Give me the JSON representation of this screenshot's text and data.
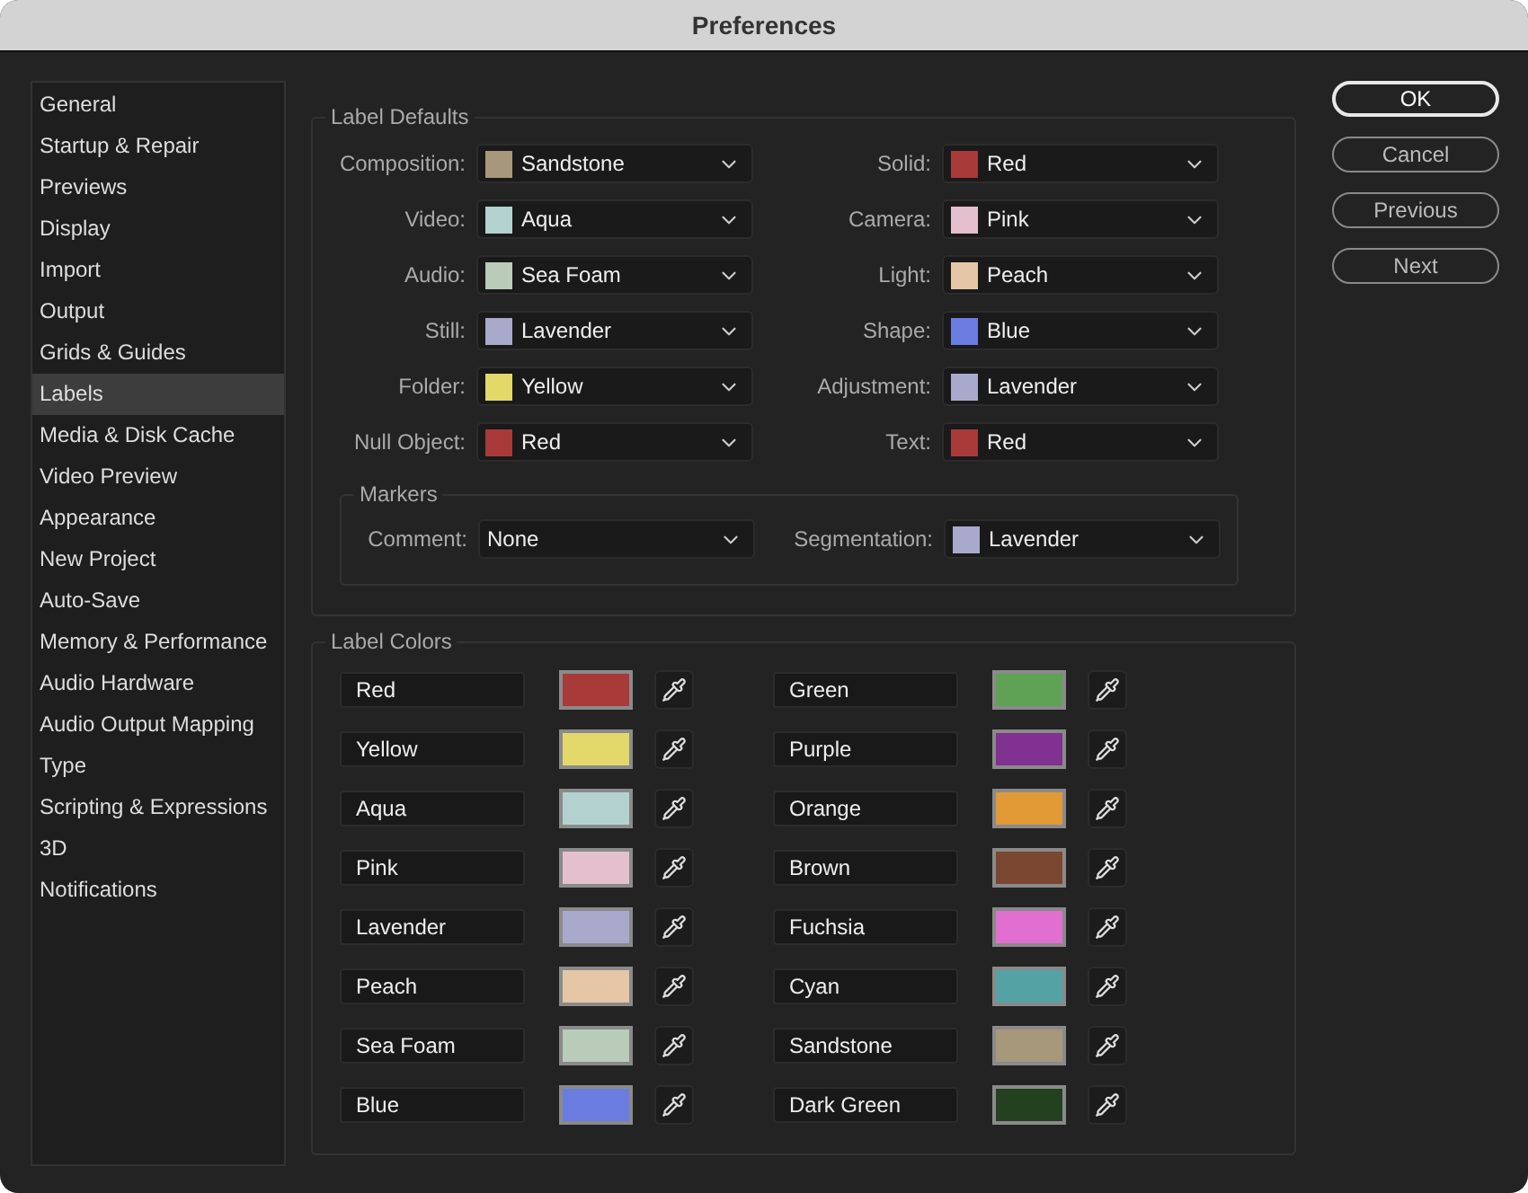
{
  "window": {
    "title": "Preferences"
  },
  "sidebar": {
    "items": [
      {
        "label": "General",
        "selected": false
      },
      {
        "label": "Startup & Repair",
        "selected": false
      },
      {
        "label": "Previews",
        "selected": false
      },
      {
        "label": "Display",
        "selected": false
      },
      {
        "label": "Import",
        "selected": false
      },
      {
        "label": "Output",
        "selected": false
      },
      {
        "label": "Grids & Guides",
        "selected": false
      },
      {
        "label": "Labels",
        "selected": true
      },
      {
        "label": "Media & Disk Cache",
        "selected": false
      },
      {
        "label": "Video Preview",
        "selected": false
      },
      {
        "label": "Appearance",
        "selected": false
      },
      {
        "label": "New Project",
        "selected": false
      },
      {
        "label": "Auto-Save",
        "selected": false
      },
      {
        "label": "Memory & Performance",
        "selected": false
      },
      {
        "label": "Audio Hardware",
        "selected": false
      },
      {
        "label": "Audio Output Mapping",
        "selected": false
      },
      {
        "label": "Type",
        "selected": false
      },
      {
        "label": "Scripting & Expressions",
        "selected": false
      },
      {
        "label": "3D",
        "selected": false
      },
      {
        "label": "Notifications",
        "selected": false
      }
    ]
  },
  "label_defaults": {
    "title": "Label Defaults",
    "fields": [
      {
        "label": "Composition:",
        "value": "Sandstone",
        "color": "#a7987c"
      },
      {
        "label": "Solid:",
        "value": "Red",
        "color": "#a83a3a"
      },
      {
        "label": "Video:",
        "value": "Aqua",
        "color": "#b3d1cf"
      },
      {
        "label": "Camera:",
        "value": "Pink",
        "color": "#e4bfcd"
      },
      {
        "label": "Audio:",
        "value": "Sea Foam",
        "color": "#b8ccb9"
      },
      {
        "label": "Light:",
        "value": "Peach",
        "color": "#e5c6a6"
      },
      {
        "label": "Still:",
        "value": "Lavender",
        "color": "#a9a9cb"
      },
      {
        "label": "Shape:",
        "value": "Blue",
        "color": "#6b7ce0"
      },
      {
        "label": "Folder:",
        "value": "Yellow",
        "color": "#e3d96a"
      },
      {
        "label": "Adjustment:",
        "value": "Lavender",
        "color": "#a9a9cb"
      },
      {
        "label": "Null Object:",
        "value": "Red",
        "color": "#a83a3a"
      },
      {
        "label": "Text:",
        "value": "Red",
        "color": "#a83a3a"
      }
    ],
    "markers": {
      "title": "Markers",
      "fields": [
        {
          "label": "Comment:",
          "value": "None"
        },
        {
          "label": "Segmentation:",
          "value": "Lavender",
          "color": "#a9a9cb"
        }
      ]
    }
  },
  "label_colors": {
    "title": "Label Colors",
    "items": [
      {
        "name": "Red",
        "color": "#a83a3a"
      },
      {
        "name": "Green",
        "color": "#5fa256"
      },
      {
        "name": "Yellow",
        "color": "#e3d96a"
      },
      {
        "name": "Purple",
        "color": "#81318f"
      },
      {
        "name": "Aqua",
        "color": "#b3d1cf"
      },
      {
        "name": "Orange",
        "color": "#e19a35"
      },
      {
        "name": "Pink",
        "color": "#e4bfcd"
      },
      {
        "name": "Brown",
        "color": "#7a4730"
      },
      {
        "name": "Lavender",
        "color": "#a9a9cb"
      },
      {
        "name": "Fuchsia",
        "color": "#e06fd0"
      },
      {
        "name": "Peach",
        "color": "#e5c6a6"
      },
      {
        "name": "Cyan",
        "color": "#55a2a5"
      },
      {
        "name": "Sea Foam",
        "color": "#b8ccb9"
      },
      {
        "name": "Sandstone",
        "color": "#a7987c"
      },
      {
        "name": "Blue",
        "color": "#6b7ce0"
      },
      {
        "name": "Dark Green",
        "color": "#23401f"
      }
    ]
  },
  "buttons": [
    {
      "label": "OK",
      "default": true
    },
    {
      "label": "Cancel",
      "default": false
    },
    {
      "label": "Previous",
      "default": false
    },
    {
      "label": "Next",
      "default": false
    }
  ]
}
